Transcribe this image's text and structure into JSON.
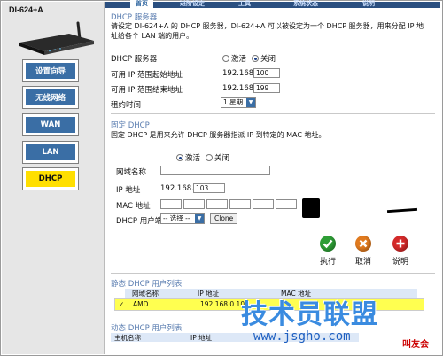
{
  "sidebar": {
    "model": "DI-624+A",
    "items": [
      {
        "label": "设置向导",
        "active": false
      },
      {
        "label": "无线网络",
        "active": false
      },
      {
        "label": "WAN",
        "active": false
      },
      {
        "label": "LAN",
        "active": false
      },
      {
        "label": "DHCP",
        "active": true
      }
    ]
  },
  "topbar": {
    "tabs": [
      "首页",
      "进阶设定",
      "工具",
      "系统状态",
      "说明"
    ]
  },
  "dhcp_server": {
    "title": "DHCP 服务器",
    "description_line1": "请设定 DI-624+A 的 DHCP 服务器，DI-624+A 可以被设定为一个 DHCP 服务器，用来分配 IP 地",
    "description_line2": "址给各个 LAN 端的用户。",
    "server_label": "DHCP 服务器",
    "enable_label": "激活",
    "disable_label": "关闭",
    "enabled": false,
    "start_label": "可用 IP 范围起始地址",
    "start_prefix": "192.168.0.",
    "start_value": "100",
    "end_label": "可用 IP 范围结束地址",
    "end_prefix": "192.168.0.",
    "end_value": "199",
    "lease_label": "租约时间",
    "lease_value": "1 星期"
  },
  "static_dhcp": {
    "title": "固定 DHCP",
    "description": "固定 DHCP 是用来允许 DHCP 服务器指派 IP 到特定的 MAC 地址。",
    "enable_label": "激活",
    "disable_label": "关闭",
    "enabled": true,
    "hostname_label": "网域名称",
    "ip_label": "IP 地址",
    "ip_prefix": "192.168.0.",
    "ip_value": "103",
    "mac_label": "MAC 地址",
    "client_label": "DHCP 用户端",
    "client_select": "-- 选择 --",
    "clone_button": "Clone"
  },
  "actions": [
    {
      "label": "执行",
      "color": "#2e9e36",
      "icon": "check-icon"
    },
    {
      "label": "取消",
      "color": "#e07a1f",
      "icon": "x-icon"
    },
    {
      "label": "说明",
      "color": "#d42a2a",
      "icon": "plus-icon"
    }
  ],
  "static_list": {
    "title": "静态 DHCP 用户列表",
    "col_hostname": "网域名称",
    "col_ip": "IP 地址",
    "col_mac": "MAC 地址",
    "rows": [
      {
        "hostname": "AMD",
        "ip": "192.168.0.103"
      }
    ]
  },
  "dynamic_list": {
    "title": "动态 DHCP 用户列表",
    "col_hostname": "主机名称",
    "col_ip": "IP 地址"
  },
  "watermark": {
    "main": "技术员联盟",
    "url": "www.jsgho.com",
    "corner": "叫友会"
  }
}
